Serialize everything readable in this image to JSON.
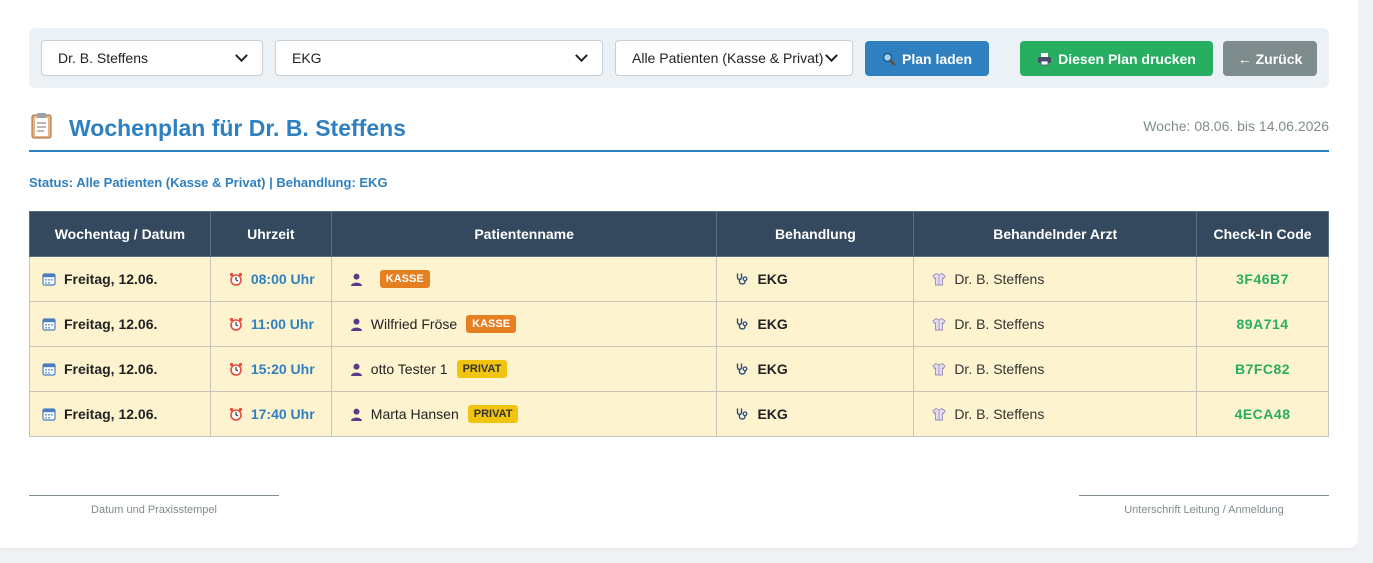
{
  "filters": {
    "doctor": "Dr. B. Steffens",
    "treatment": "EKG",
    "patient_status": "Alle Patienten (Kasse & Privat)"
  },
  "buttons": {
    "load": "Plan laden",
    "print": "Diesen Plan drucken",
    "back": "← Zurück"
  },
  "header": {
    "title": "Wochenplan für Dr. B. Steffens",
    "week": "Woche: 08.06. bis 14.06.2026"
  },
  "status_line": "Status: Alle Patienten (Kasse & Privat) | Behandlung: EKG",
  "table": {
    "columns": [
      "Wochentag / Datum",
      "Uhrzeit",
      "Patientenname",
      "Behandlung",
      "Behandelnder Arzt",
      "Check-In Code"
    ],
    "rows": [
      {
        "day": "Freitag, 12.06.",
        "time": "08:00 Uhr",
        "patient": "",
        "badge": "KASSE",
        "badge_type": "kasse",
        "treatment": "EKG",
        "doctor": "Dr. B. Steffens",
        "code": "3F46B7"
      },
      {
        "day": "Freitag, 12.06.",
        "time": "11:00 Uhr",
        "patient": "Wilfried Fröse",
        "badge": "KASSE",
        "badge_type": "kasse",
        "treatment": "EKG",
        "doctor": "Dr. B. Steffens",
        "code": "89A714"
      },
      {
        "day": "Freitag, 12.06.",
        "time": "15:20 Uhr",
        "patient": "otto Tester 1",
        "badge": "PRIVAT",
        "badge_type": "privat",
        "treatment": "EKG",
        "doctor": "Dr. B. Steffens",
        "code": "B7FC82"
      },
      {
        "day": "Freitag, 12.06.",
        "time": "17:40 Uhr",
        "patient": "Marta Hansen",
        "badge": "PRIVAT",
        "badge_type": "privat",
        "treatment": "EKG",
        "doctor": "Dr. B. Steffens",
        "code": "4ECA48"
      }
    ]
  },
  "signatures": {
    "left": "Datum und Praxisstempel",
    "right": "Unterschrift Leitung / Anmeldung"
  },
  "colors": {
    "accent": "#2f80c0",
    "success": "#27ae60",
    "header_bg": "#34495e",
    "row_bg": "#fdf3cf",
    "kasse": "#e67e22",
    "privat": "#f1c40f"
  },
  "icons": {
    "title": "clipboard-icon",
    "day": "calendar-icon",
    "time": "alarm-clock-icon",
    "patient": "person-icon",
    "treatment": "stethoscope-icon",
    "doctor": "doctor-coat-icon",
    "load": "magnifier-icon",
    "print": "printer-icon"
  }
}
